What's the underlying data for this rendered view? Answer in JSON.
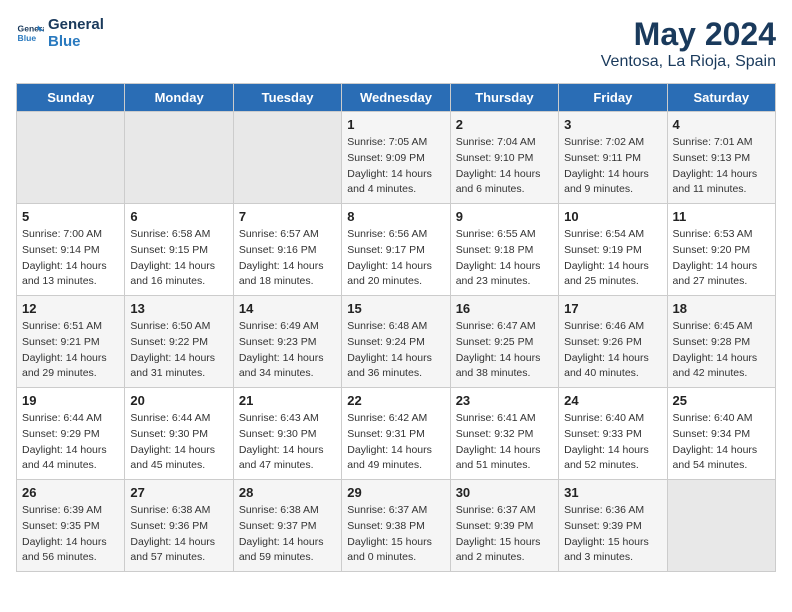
{
  "header": {
    "logo_line1": "General",
    "logo_line2": "Blue",
    "title": "May 2024",
    "subtitle": "Ventosa, La Rioja, Spain"
  },
  "days_of_week": [
    "Sunday",
    "Monday",
    "Tuesday",
    "Wednesday",
    "Thursday",
    "Friday",
    "Saturday"
  ],
  "weeks": [
    [
      {
        "num": "",
        "sunrise": "",
        "sunset": "",
        "daylight": ""
      },
      {
        "num": "",
        "sunrise": "",
        "sunset": "",
        "daylight": ""
      },
      {
        "num": "",
        "sunrise": "",
        "sunset": "",
        "daylight": ""
      },
      {
        "num": "1",
        "sunrise": "Sunrise: 7:05 AM",
        "sunset": "Sunset: 9:09 PM",
        "daylight": "Daylight: 14 hours and 4 minutes."
      },
      {
        "num": "2",
        "sunrise": "Sunrise: 7:04 AM",
        "sunset": "Sunset: 9:10 PM",
        "daylight": "Daylight: 14 hours and 6 minutes."
      },
      {
        "num": "3",
        "sunrise": "Sunrise: 7:02 AM",
        "sunset": "Sunset: 9:11 PM",
        "daylight": "Daylight: 14 hours and 9 minutes."
      },
      {
        "num": "4",
        "sunrise": "Sunrise: 7:01 AM",
        "sunset": "Sunset: 9:13 PM",
        "daylight": "Daylight: 14 hours and 11 minutes."
      }
    ],
    [
      {
        "num": "5",
        "sunrise": "Sunrise: 7:00 AM",
        "sunset": "Sunset: 9:14 PM",
        "daylight": "Daylight: 14 hours and 13 minutes."
      },
      {
        "num": "6",
        "sunrise": "Sunrise: 6:58 AM",
        "sunset": "Sunset: 9:15 PM",
        "daylight": "Daylight: 14 hours and 16 minutes."
      },
      {
        "num": "7",
        "sunrise": "Sunrise: 6:57 AM",
        "sunset": "Sunset: 9:16 PM",
        "daylight": "Daylight: 14 hours and 18 minutes."
      },
      {
        "num": "8",
        "sunrise": "Sunrise: 6:56 AM",
        "sunset": "Sunset: 9:17 PM",
        "daylight": "Daylight: 14 hours and 20 minutes."
      },
      {
        "num": "9",
        "sunrise": "Sunrise: 6:55 AM",
        "sunset": "Sunset: 9:18 PM",
        "daylight": "Daylight: 14 hours and 23 minutes."
      },
      {
        "num": "10",
        "sunrise": "Sunrise: 6:54 AM",
        "sunset": "Sunset: 9:19 PM",
        "daylight": "Daylight: 14 hours and 25 minutes."
      },
      {
        "num": "11",
        "sunrise": "Sunrise: 6:53 AM",
        "sunset": "Sunset: 9:20 PM",
        "daylight": "Daylight: 14 hours and 27 minutes."
      }
    ],
    [
      {
        "num": "12",
        "sunrise": "Sunrise: 6:51 AM",
        "sunset": "Sunset: 9:21 PM",
        "daylight": "Daylight: 14 hours and 29 minutes."
      },
      {
        "num": "13",
        "sunrise": "Sunrise: 6:50 AM",
        "sunset": "Sunset: 9:22 PM",
        "daylight": "Daylight: 14 hours and 31 minutes."
      },
      {
        "num": "14",
        "sunrise": "Sunrise: 6:49 AM",
        "sunset": "Sunset: 9:23 PM",
        "daylight": "Daylight: 14 hours and 34 minutes."
      },
      {
        "num": "15",
        "sunrise": "Sunrise: 6:48 AM",
        "sunset": "Sunset: 9:24 PM",
        "daylight": "Daylight: 14 hours and 36 minutes."
      },
      {
        "num": "16",
        "sunrise": "Sunrise: 6:47 AM",
        "sunset": "Sunset: 9:25 PM",
        "daylight": "Daylight: 14 hours and 38 minutes."
      },
      {
        "num": "17",
        "sunrise": "Sunrise: 6:46 AM",
        "sunset": "Sunset: 9:26 PM",
        "daylight": "Daylight: 14 hours and 40 minutes."
      },
      {
        "num": "18",
        "sunrise": "Sunrise: 6:45 AM",
        "sunset": "Sunset: 9:28 PM",
        "daylight": "Daylight: 14 hours and 42 minutes."
      }
    ],
    [
      {
        "num": "19",
        "sunrise": "Sunrise: 6:44 AM",
        "sunset": "Sunset: 9:29 PM",
        "daylight": "Daylight: 14 hours and 44 minutes."
      },
      {
        "num": "20",
        "sunrise": "Sunrise: 6:44 AM",
        "sunset": "Sunset: 9:30 PM",
        "daylight": "Daylight: 14 hours and 45 minutes."
      },
      {
        "num": "21",
        "sunrise": "Sunrise: 6:43 AM",
        "sunset": "Sunset: 9:30 PM",
        "daylight": "Daylight: 14 hours and 47 minutes."
      },
      {
        "num": "22",
        "sunrise": "Sunrise: 6:42 AM",
        "sunset": "Sunset: 9:31 PM",
        "daylight": "Daylight: 14 hours and 49 minutes."
      },
      {
        "num": "23",
        "sunrise": "Sunrise: 6:41 AM",
        "sunset": "Sunset: 9:32 PM",
        "daylight": "Daylight: 14 hours and 51 minutes."
      },
      {
        "num": "24",
        "sunrise": "Sunrise: 6:40 AM",
        "sunset": "Sunset: 9:33 PM",
        "daylight": "Daylight: 14 hours and 52 minutes."
      },
      {
        "num": "25",
        "sunrise": "Sunrise: 6:40 AM",
        "sunset": "Sunset: 9:34 PM",
        "daylight": "Daylight: 14 hours and 54 minutes."
      }
    ],
    [
      {
        "num": "26",
        "sunrise": "Sunrise: 6:39 AM",
        "sunset": "Sunset: 9:35 PM",
        "daylight": "Daylight: 14 hours and 56 minutes."
      },
      {
        "num": "27",
        "sunrise": "Sunrise: 6:38 AM",
        "sunset": "Sunset: 9:36 PM",
        "daylight": "Daylight: 14 hours and 57 minutes."
      },
      {
        "num": "28",
        "sunrise": "Sunrise: 6:38 AM",
        "sunset": "Sunset: 9:37 PM",
        "daylight": "Daylight: 14 hours and 59 minutes."
      },
      {
        "num": "29",
        "sunrise": "Sunrise: 6:37 AM",
        "sunset": "Sunset: 9:38 PM",
        "daylight": "Daylight: 15 hours and 0 minutes."
      },
      {
        "num": "30",
        "sunrise": "Sunrise: 6:37 AM",
        "sunset": "Sunset: 9:39 PM",
        "daylight": "Daylight: 15 hours and 2 minutes."
      },
      {
        "num": "31",
        "sunrise": "Sunrise: 6:36 AM",
        "sunset": "Sunset: 9:39 PM",
        "daylight": "Daylight: 15 hours and 3 minutes."
      },
      {
        "num": "",
        "sunrise": "",
        "sunset": "",
        "daylight": ""
      }
    ]
  ]
}
